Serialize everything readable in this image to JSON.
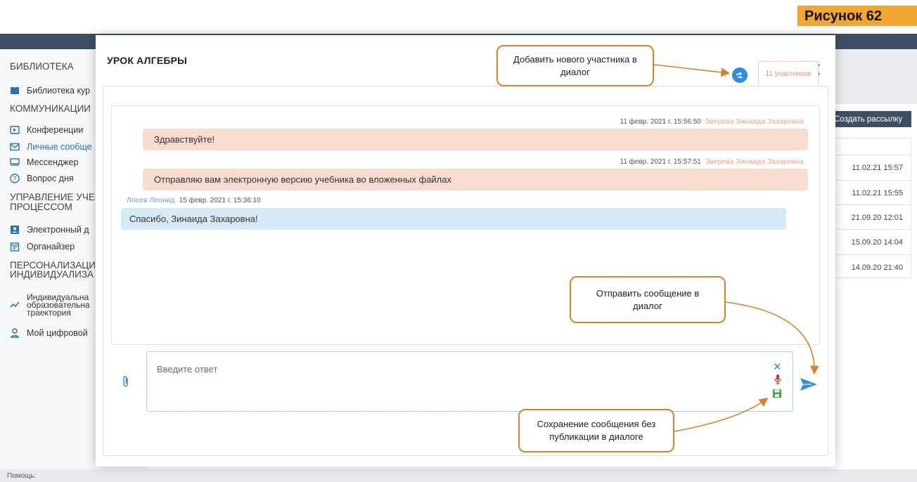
{
  "figure_label": "Рисунок 62",
  "sidebar": {
    "sections": [
      {
        "label": "БИБЛИОТЕКА"
      },
      {
        "label": "КОММУНИКАЦИИ"
      },
      {
        "label": "УПРАВЛЕНИЕ УЧЕБ"
      },
      {
        "label": "ПРОЦЕССОМ"
      },
      {
        "label": "ПЕРСОНАЛИЗАЦИЯ"
      },
      {
        "label": "ИНДИВИДУАЛИЗА"
      }
    ],
    "items": [
      {
        "label": "Библиотека кур",
        "icon": "book-icon"
      },
      {
        "label": "Конференции",
        "icon": "video-icon"
      },
      {
        "label": "Личные сообще",
        "icon": "mail-icon"
      },
      {
        "label": "Мессенджер",
        "icon": "chat-icon"
      },
      {
        "label": "Вопрос дня",
        "icon": "question-icon"
      },
      {
        "label": "Электронный д",
        "icon": "journal-icon"
      },
      {
        "label": "Органайзер",
        "icon": "calendar-icon"
      },
      {
        "label": "Индивидуальна",
        "line2": "образовательна",
        "line3": "траектория",
        "icon": "trajectory-icon"
      },
      {
        "label": "Мой цифровой",
        "icon": "user-icon"
      }
    ]
  },
  "background": {
    "broadcast_button": "Создать рассылку",
    "dates": [
      "11.02.21 15:57",
      "11.02.21 15:55",
      "21.09.20 12:01",
      "15.09.20 14:04",
      "14.09.20 21:40"
    ],
    "footer_text": "Помощь:"
  },
  "modal": {
    "title": "УРОК АЛГЕБРЫ",
    "participants_label": "11 участников",
    "messages": [
      {
        "direction": "out",
        "time": "11 февр. 2021 г. 15:56:50",
        "author": "Зверева Зинаида Захаровна",
        "text": "Здравствуйте!"
      },
      {
        "direction": "out",
        "time": "11 февр. 2021 г. 15:57:51",
        "author": "Зверева Зинаида Захаровна",
        "text": "Отправляю вам электронную версию учебника во вложенных файлах"
      },
      {
        "direction": "in",
        "time": "15 февр. 2021 г. 15:36:10",
        "author": "Лосев Леонид",
        "text": "Спасибо, Зинаида Захаровна!"
      }
    ],
    "reply_placeholder": "Введите ответ"
  },
  "callouts": {
    "add_participant": [
      "Добавить нового участника в",
      "диалог"
    ],
    "send_message": [
      "Отправить сообщение в",
      "диалог"
    ],
    "save_draft": [
      "Сохранение сообщения без",
      "публикации в диалоге"
    ]
  },
  "colors": {
    "accent": "#2f8de4",
    "callout_border": "#d9822b",
    "outgoing_bubble": "#f8dcd0",
    "incoming_bubble": "#d5e9f7",
    "figure_label_bg": "#f0a732"
  }
}
